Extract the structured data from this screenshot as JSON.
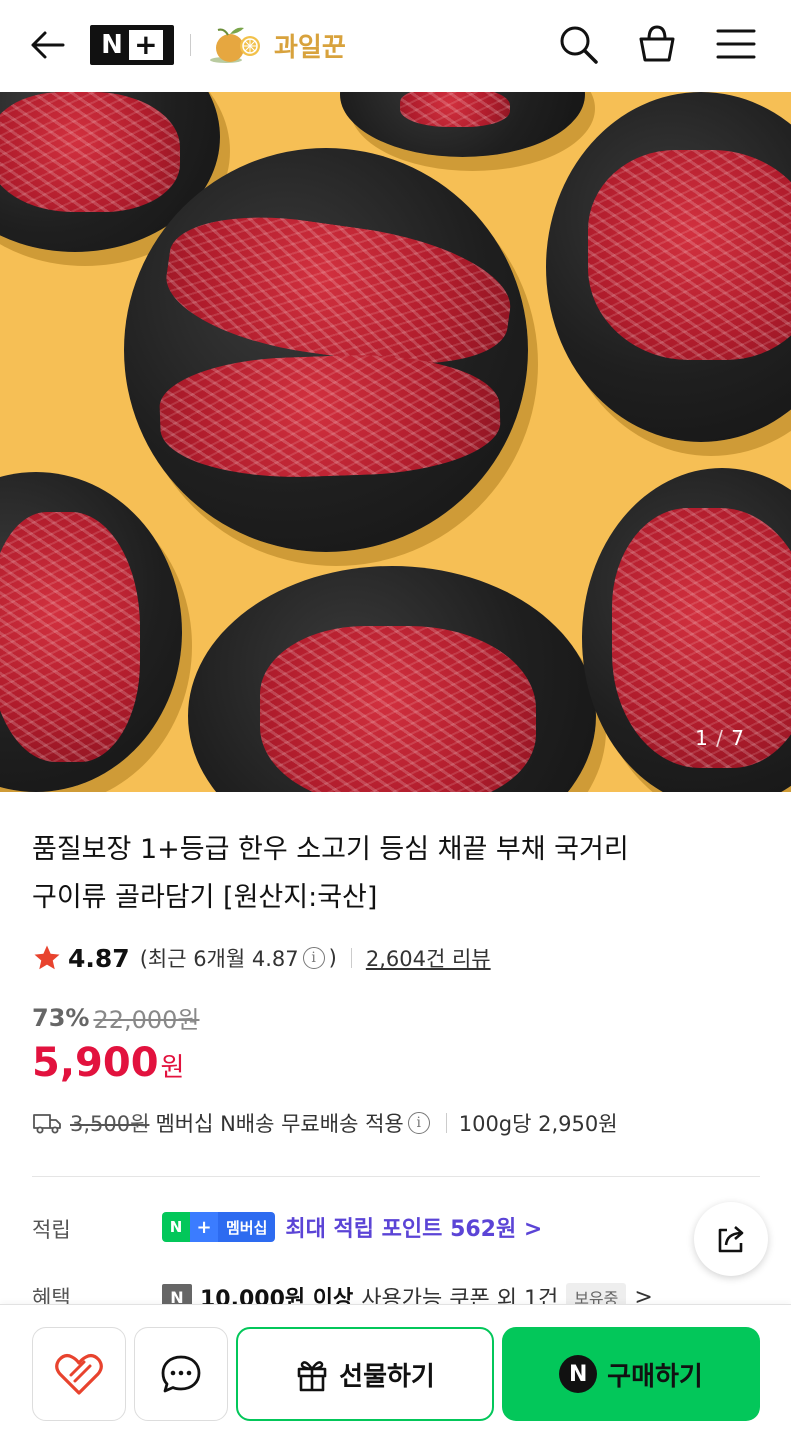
{
  "header": {
    "back_icon": "arrow-left-icon",
    "logo_n": "N",
    "logo_plus": "+",
    "store_name": "과일꾼",
    "search_icon": "search-icon",
    "cart_icon": "shopping-basket-icon",
    "menu_icon": "hamburger-menu-icon"
  },
  "hero": {
    "image_index": "1",
    "image_total": "7"
  },
  "product": {
    "title_line1": "품질보장 1+등급 한우 소고기 등심 채끝 부채 국거리",
    "title_line2": "구이류 골라담기 [원산지:국산]",
    "rating": "4.87",
    "rating_recent": "(최근 6개월 4.87",
    "rating_recent_close": ")",
    "review_count": "2,604건 리뷰",
    "discount": "73%",
    "original_price": "22,000원",
    "sale_price": "5,900",
    "currency": "원"
  },
  "shipping": {
    "old_fee": "3,500원",
    "text": "멤버십 N배송 무료배송 적용",
    "unit_price": "100g당 2,950원"
  },
  "points": {
    "label": "적립",
    "badge_n": "N",
    "badge_plus": "+",
    "badge_membership": "멤버십",
    "text": "최대 적립 포인트 562원 >"
  },
  "benefit": {
    "label": "혜택",
    "n_mark": "N",
    "text_bold": "10,000원 이상",
    "text": "사용가능 쿠폰 외 1건",
    "hold": "보유중",
    "chevron": ">"
  },
  "bottom": {
    "gift_label": "선물하기",
    "buy_n": "N",
    "buy_label": "구매하기"
  },
  "colors": {
    "naver_green": "#03c75a",
    "sale_red": "#e2123e",
    "point_purple": "#5b44d6",
    "hero_bg": "#f6bf55"
  }
}
